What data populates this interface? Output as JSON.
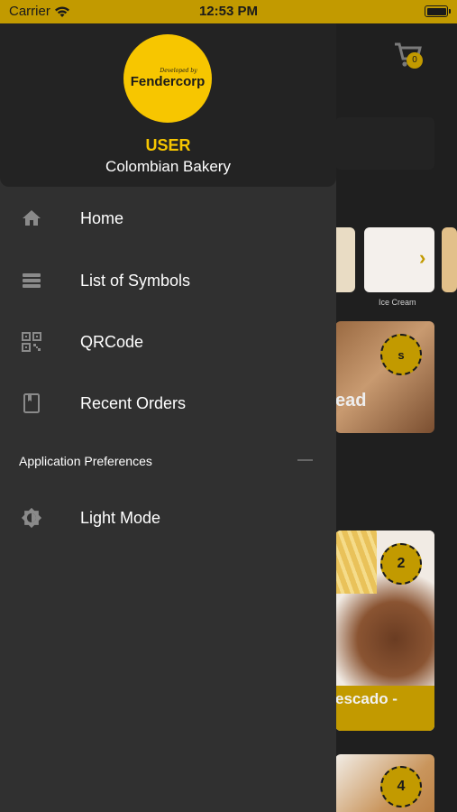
{
  "status_bar": {
    "carrier": "Carrier",
    "time": "12:53 PM",
    "bg_color": "#c29a00"
  },
  "drawer": {
    "logo": {
      "tagline": "Developed by",
      "name": "Fendercorp"
    },
    "user_name": "USER",
    "store_name": "Colombian Bakery",
    "menu_items": [
      {
        "label": "Home",
        "icon": "home-icon"
      },
      {
        "label": "List of Symbols",
        "icon": "list-icon"
      },
      {
        "label": "QRCode",
        "icon": "qrcode-icon"
      },
      {
        "label": "Recent Orders",
        "icon": "orders-icon"
      }
    ],
    "section_title": "Application Preferences",
    "preferences": [
      {
        "label": "Light Mode",
        "icon": "brightness-icon"
      }
    ]
  },
  "background": {
    "cart_count": "0",
    "category_label": "Ice Cream",
    "card1_text": "ead",
    "card1_badge": "s",
    "card2_text": "escado -",
    "card2_badge": "2",
    "card3_badge": "4"
  },
  "colors": {
    "accent": "#f7c600",
    "status": "#c29a00",
    "drawer": "#303030",
    "drawer_header": "#232323"
  }
}
